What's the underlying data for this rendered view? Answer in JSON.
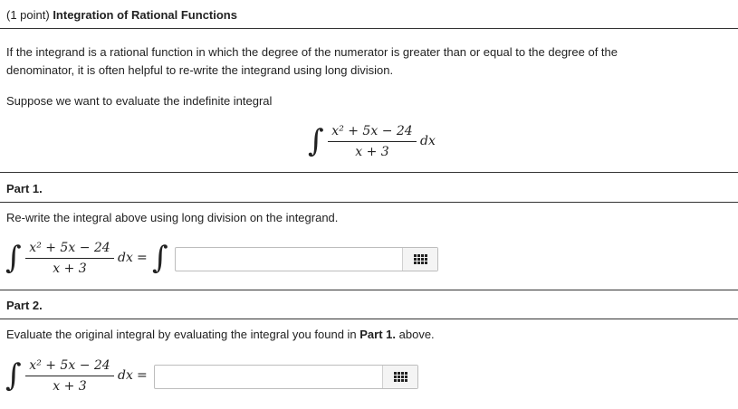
{
  "header": {
    "points": "(1 point) ",
    "title": "Integration of Rational Functions"
  },
  "intro": {
    "line1": "If the integrand is a rational function in which the degree of the numerator is greater than or equal to the degree of the",
    "line2": "denominator, it is often helpful to re-write the integrand using long division.",
    "suppose": "Suppose we want to evaluate the indefinite integral"
  },
  "integrand": {
    "numerator": "x² + 5x − 24",
    "denominator": "x + 3",
    "dx": "dx"
  },
  "part1": {
    "heading": "Part 1.",
    "instruction": "Re-write the integral above using long division on the integrand.",
    "answer_value": ""
  },
  "part2": {
    "heading": "Part 2.",
    "instruction_prefix": "Evaluate the original integral by evaluating the integral you found in ",
    "instruction_bold": "Part 1.",
    "instruction_suffix": " above.",
    "answer_value": ""
  },
  "icons": {
    "equation_editor": "grid-icon"
  }
}
